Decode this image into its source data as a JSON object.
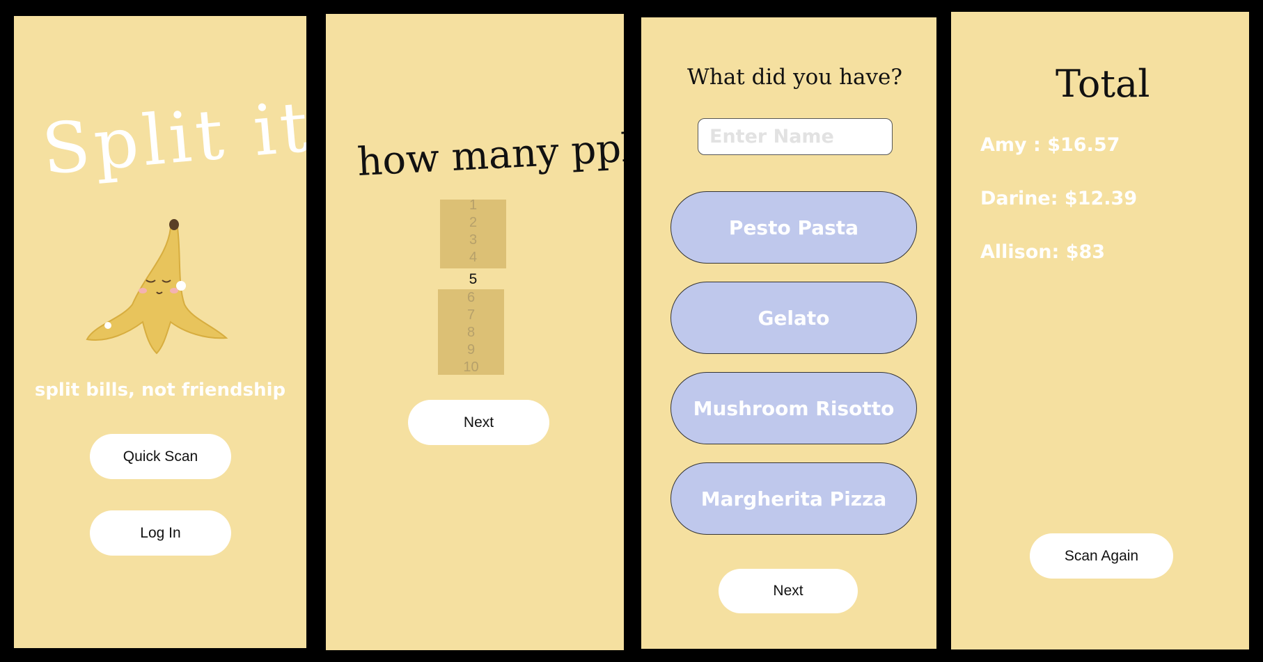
{
  "colors": {
    "background": "#000000",
    "screen": "#f5e0a0",
    "button": "#ffffff",
    "food_button": "#bfc8ec",
    "picker_block": "#dcc075"
  },
  "welcome": {
    "title": "Split it!",
    "mascot": "banana-peel-mascot",
    "tagline": "split bills, not friendship",
    "quick_scan_label": "Quick Scan",
    "login_label": "Log In"
  },
  "people_count": {
    "question": "how many ppl?",
    "options_above": [
      "1",
      "2",
      "3",
      "4"
    ],
    "selected": "5",
    "options_below": [
      "6",
      "7",
      "8",
      "9",
      "10"
    ],
    "next_label": "Next"
  },
  "order": {
    "question": "What did you have?",
    "name_placeholder": "Enter Name",
    "name_value": "",
    "items": [
      "Pesto Pasta",
      "Gelato",
      "Mushroom Risotto",
      "Margherita Pizza"
    ],
    "next_label": "Next"
  },
  "total": {
    "title": "Total",
    "lines": [
      "Amy : $16.57",
      "Darine: $12.39",
      "Allison: $83"
    ],
    "scan_again_label": "Scan Again"
  }
}
